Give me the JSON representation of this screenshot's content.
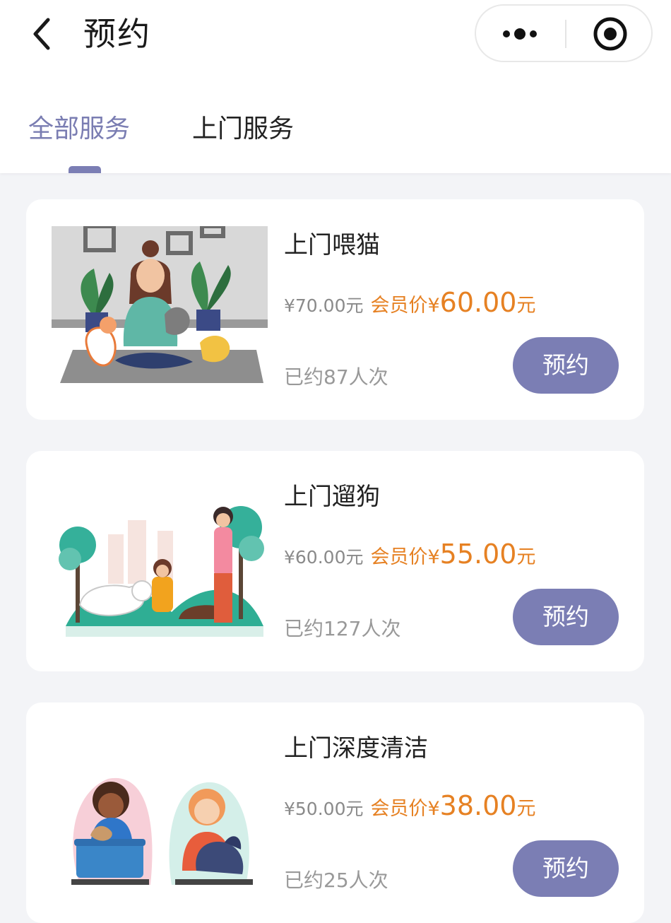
{
  "nav": {
    "title": "预约",
    "back_icon": "chevron-left-icon",
    "more_icon": "more-dots-icon",
    "target_icon": "close-target-icon"
  },
  "tabs": [
    {
      "label": "全部服务",
      "active": true
    },
    {
      "label": "上门服务",
      "active": false
    }
  ],
  "colors": {
    "accent": "#7b7eb4",
    "price": "#e68123",
    "background": "#f3f4f7"
  },
  "services": [
    {
      "name": "上门喂猫",
      "orig_price": "¥70.00元",
      "member_label": "会员价¥",
      "member_price": "60.00",
      "member_unit": "元",
      "booked": "已约87人次",
      "button": "预约",
      "image": "cat-feeding-illustration"
    },
    {
      "name": "上门遛狗",
      "orig_price": "¥60.00元",
      "member_label": "会员价¥",
      "member_price": "55.00",
      "member_unit": "元",
      "booked": "已约127人次",
      "button": "预约",
      "image": "dog-walking-illustration"
    },
    {
      "name": "上门深度清洁",
      "orig_price": "¥50.00元",
      "member_label": "会员价¥",
      "member_price": "38.00",
      "member_unit": "元",
      "booked": "已约25人次",
      "button": "预约",
      "image": "pet-grooming-illustration"
    }
  ]
}
